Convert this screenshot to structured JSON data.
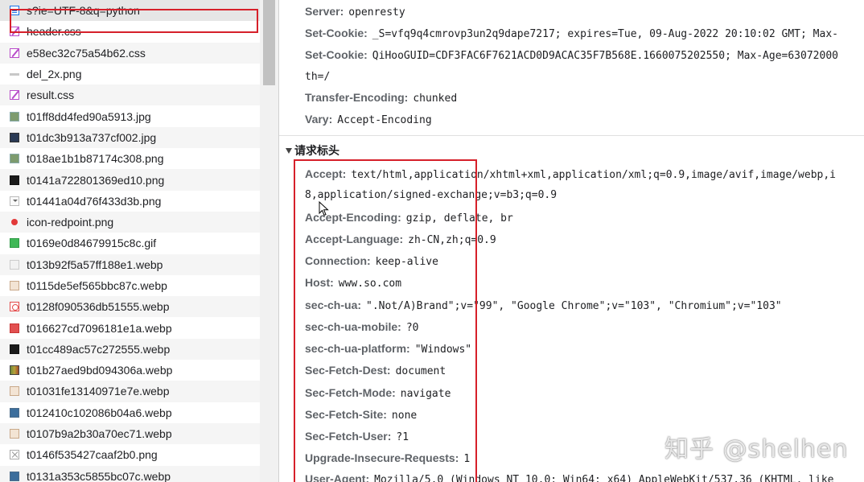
{
  "requests": [
    {
      "name": "s?ie=UTF-8&q=python",
      "icon": "document-icon",
      "selected": true
    },
    {
      "name": "header.css",
      "icon": "stylesheet-icon"
    },
    {
      "name": "e58ec32c75a54b62.css",
      "icon": "stylesheet-icon"
    },
    {
      "name": "del_2x.png",
      "icon": "image-icon"
    },
    {
      "name": "result.css",
      "icon": "stylesheet-icon"
    },
    {
      "name": "t01ff8dd4fed90a5913.jpg",
      "icon": "image-icon"
    },
    {
      "name": "t01dc3b913a737cf002.jpg",
      "icon": "image-icon"
    },
    {
      "name": "t018ae1b1b87174c308.png",
      "icon": "image-icon"
    },
    {
      "name": "t0141a722801369ed10.png",
      "icon": "image-icon"
    },
    {
      "name": "t01441a04d76f433d3b.png",
      "icon": "image-icon"
    },
    {
      "name": "icon-redpoint.png",
      "icon": "image-icon"
    },
    {
      "name": "t0169e0d84679915c8c.gif",
      "icon": "image-icon"
    },
    {
      "name": "t013b92f5a57ff188e1.webp",
      "icon": "image-icon"
    },
    {
      "name": "t0115de5ef565bbc87c.webp",
      "icon": "image-icon"
    },
    {
      "name": "t0128f090536db51555.webp",
      "icon": "image-icon"
    },
    {
      "name": "t016627cd7096181e1a.webp",
      "icon": "image-icon"
    },
    {
      "name": "t01cc489ac57c272555.webp",
      "icon": "image-icon"
    },
    {
      "name": "t01b27aed9bd094306a.webp",
      "icon": "image-icon"
    },
    {
      "name": "t01031fe13140971e7e.webp",
      "icon": "image-icon"
    },
    {
      "name": "t012410c102086b04a6.webp",
      "icon": "image-icon"
    },
    {
      "name": "t0107b9a2b30a70ec71.webp",
      "icon": "image-icon"
    },
    {
      "name": "t0146f535427caaf2b0.png",
      "icon": "image-icon"
    },
    {
      "name": "t0131a353c5855bc07c.webp",
      "icon": "image-icon"
    }
  ],
  "response_headers": [
    {
      "name": "Server:",
      "value": "openresty"
    },
    {
      "name": "Set-Cookie:",
      "value": "_S=vfq9q4cmrovp3un2q9dape7217; expires=Tue, 09-Aug-2022 20:10:02 GMT; Max-"
    },
    {
      "name": "Set-Cookie:",
      "value": "QiHooGUID=CDF3FAC6F7621ACD0D9ACAC35F7B568E.1660075202550; Max-Age=63072000",
      "continuation": "th=/"
    },
    {
      "name": "Transfer-Encoding:",
      "value": "chunked"
    },
    {
      "name": "Vary:",
      "value": "Accept-Encoding"
    }
  ],
  "request_section_title": "请求标头",
  "request_headers": [
    {
      "name": "Accept:",
      "value": "text/html,application/xhtml+xml,application/xml;q=0.9,image/avif,image/webp,i",
      "continuation": "8,application/signed-exchange;v=b3;q=0.9"
    },
    {
      "name": "Accept-Encoding:",
      "value": "gzip, deflate, br"
    },
    {
      "name": "Accept-Language:",
      "value": "zh-CN,zh;q=0.9"
    },
    {
      "name": "Connection:",
      "value": "keep-alive"
    },
    {
      "name": "Host:",
      "value": "www.so.com"
    },
    {
      "name": "sec-ch-ua:",
      "value": "\".Not/A)Brand\";v=\"99\", \"Google Chrome\";v=\"103\", \"Chromium\";v=\"103\""
    },
    {
      "name": "sec-ch-ua-mobile:",
      "value": "?0"
    },
    {
      "name": "sec-ch-ua-platform:",
      "value": "\"Windows\""
    },
    {
      "name": "Sec-Fetch-Dest:",
      "value": "document"
    },
    {
      "name": "Sec-Fetch-Mode:",
      "value": "navigate"
    },
    {
      "name": "Sec-Fetch-Site:",
      "value": "none"
    },
    {
      "name": "Sec-Fetch-User:",
      "value": "?1"
    },
    {
      "name": "Upgrade-Insecure-Requests:",
      "value": "1"
    },
    {
      "name": "User-Agent:",
      "value": "Mozilla/5.0 (Windows NT 10.0; Win64; x64) AppleWebKit/537.36 (KHTML, like"
    }
  ],
  "watermark": "知乎 @shelhen",
  "colors": {
    "annotation": "#d6202a",
    "header_name": "#5f6368",
    "selected_row": "#e6e6e6"
  }
}
